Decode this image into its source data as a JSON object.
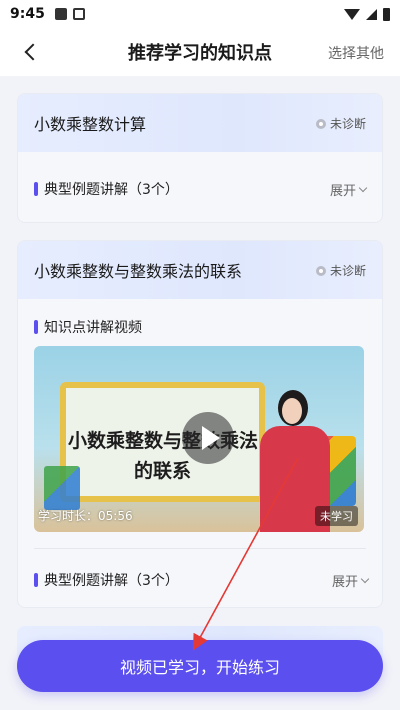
{
  "status_bar": {
    "time": "9:45"
  },
  "header": {
    "title": "推荐学习的知识点",
    "right_action": "选择其他"
  },
  "cards": [
    {
      "title": "小数乘整数计算",
      "status": "未诊断",
      "rows": [
        {
          "label": "典型例题讲解（3个）",
          "action": "展开"
        }
      ]
    },
    {
      "title": "小数乘整数与整数乘法的联系",
      "status": "未诊断",
      "section_label": "知识点讲解视频",
      "video": {
        "line1": "小数乘整数与整数乘法",
        "line2": "的联系",
        "duration": "学习时长：05:56",
        "badge": "未学习"
      },
      "rows": [
        {
          "label": "典型例题讲解（3个）",
          "action": "展开"
        }
      ]
    }
  ],
  "cta_button": "视频已学习，开始练习",
  "annotation_color": "#e53935"
}
